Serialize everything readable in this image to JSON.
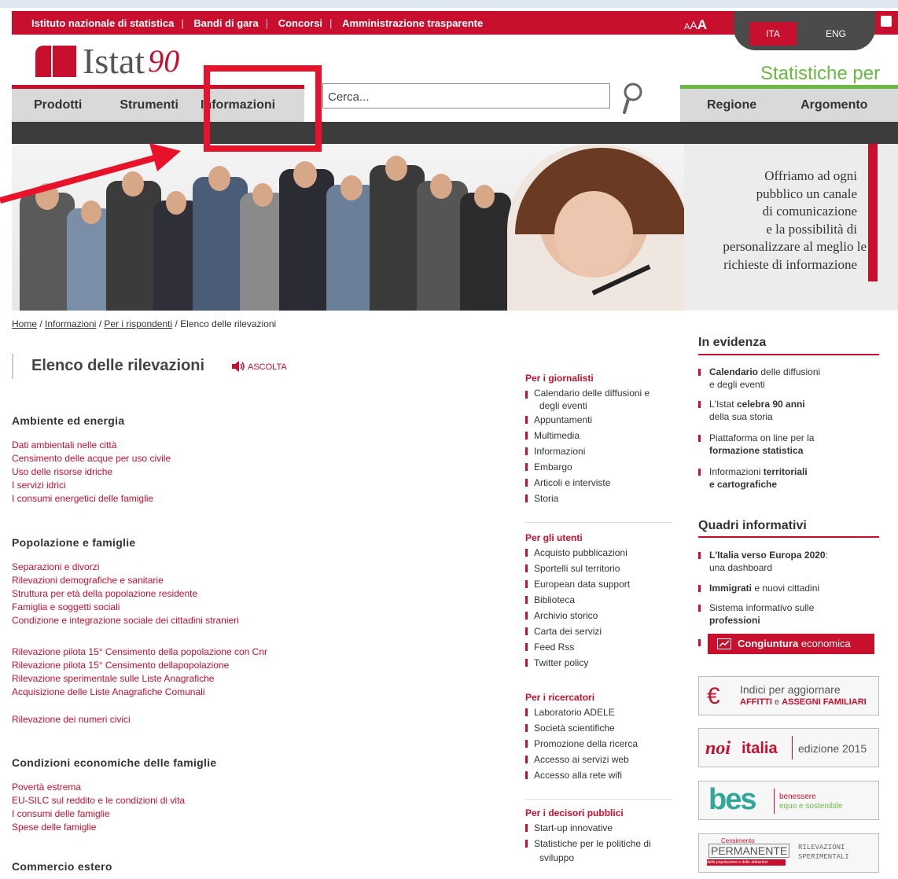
{
  "top_links": [
    "Istituto nazionale di statistica",
    "Bandi di gara",
    "Concorsi",
    "Amministrazione trasparente"
  ],
  "font_size": {
    "small": "A",
    "medium": "A",
    "large": "A"
  },
  "lang": {
    "ita": "ITA",
    "eng": "ENG"
  },
  "logo": {
    "text": "Istat",
    "ninety": "90"
  },
  "nav": {
    "items": [
      "Prodotti",
      "Strumenti",
      "Informazioni"
    ]
  },
  "search": {
    "placeholder": "Cerca..."
  },
  "stat_per": "Statistiche per",
  "right_nav": [
    "Regione",
    "Argomento"
  ],
  "hero_text": [
    "Offriamo ad ogni",
    "pubblico un canale",
    "di comunicazione",
    "e la possibilità di",
    "personalizzare al meglio le",
    "richieste di informazione"
  ],
  "breadcrumb": {
    "home": "Home",
    "informazioni": "Informazioni",
    "rispondenti": "Per i rispondenti",
    "current": "Elenco delle rilevazioni"
  },
  "page_title": "Elenco delle rilevazioni",
  "ascolta": "ASCOLTA",
  "sections": [
    {
      "title": "Ambiente ed energia",
      "groups": [
        [
          "Dati ambientali nelle città",
          "Censimento delle acque per uso civile",
          "Uso delle risorse idriche",
          "I servizi idrici",
          "I consumi energetici delle famiglie"
        ]
      ]
    },
    {
      "title": "Popolazione e famiglie",
      "groups": [
        [
          "Separazioni e divorzi",
          "Rilevazioni demografiche e sanitarie",
          "Struttura per età della popolazione residente",
          "Famiglia e soggetti sociali",
          "Condizione e integrazione sociale dei cittadini stranieri"
        ],
        [
          "Rilevazione pilota 15° Censimento della popolazione con Cnr",
          "Rilevazione pilota 15° Censimento dellapopolazione",
          "Rilevazione sperimentale sulle Liste Anagrafiche",
          "Acquisizione delle Liste Anagrafiche Comunali"
        ],
        [
          "Rilevazione dei numeri civici"
        ]
      ]
    },
    {
      "title": "Condizioni economiche delle famiglie",
      "groups": [
        [
          "Povertà estrema",
          "EU-SILC sul reddito e le condizioni di vita",
          "I consumi delle famiglie",
          "Spese delle famiglie"
        ]
      ]
    },
    {
      "title": "Commercio estero",
      "groups": []
    }
  ],
  "mid": {
    "giornalisti": {
      "title": "Per i giornalisti",
      "items": [
        "Calendario delle diffusioni e",
        "degli eventi",
        "Appuntamenti",
        "Multimedia",
        "Informazioni",
        "Embargo",
        "Articoli e interviste",
        "Storia"
      ]
    },
    "utenti": {
      "title": "Per gli utenti",
      "items": [
        "Acquisto pubblicazioni",
        "Sportelli sul territorio",
        "European data support",
        "Biblioteca",
        "Archivio storico",
        "Carta dei servizi",
        "Feed Rss",
        "Twitter policy"
      ]
    },
    "ricercatori": {
      "title": "Per i ricercatori",
      "items": [
        "Laboratorio ADELE",
        "Società scientifiche",
        "Promozione della ricerca",
        "Accesso ai servizi web",
        "Accesso alla rete wifi"
      ]
    },
    "decisori": {
      "title": "Per i decisori pubblici",
      "items": [
        "Start-up innovative",
        "Statistiche per le politiche di",
        "sviluppo"
      ]
    }
  },
  "evidenza": {
    "title": "In evidenza",
    "items": [
      {
        "b": "Calendario",
        "t": " delle diffusioni",
        "l2": "e degli eventi"
      },
      {
        "a": "L'Istat ",
        "b": "celebra 90 anni",
        "l2": "della sua storia"
      },
      {
        "a": "Piattaforma on line per la",
        "l2b": "formazione statistica"
      },
      {
        "a": "Informazioni ",
        "b": "territoriali",
        "l2b": "e cartografiche"
      }
    ]
  },
  "quadri": {
    "title": "Quadri informativi",
    "items": [
      {
        "b": "L'Italia verso Europa 2020",
        "t": ":",
        "l2": "una dashboard"
      },
      {
        "b": "Immigrati",
        "t": " e nuovi cittadini"
      },
      {
        "a": "Sistema informativo sulle",
        "l2b": "professioni"
      }
    ],
    "congiuntura": {
      "b": "Congiuntura",
      "t": " economica"
    }
  },
  "banners": {
    "indici": {
      "l1": "Indici per aggiornare",
      "b1": "AFFITTI",
      "mid": " e ",
      "b2": "ASSEGNI FAMILIARI"
    },
    "noi": {
      "logo": "noi",
      "logo2": "italia",
      "edizione": "edizione 2015"
    },
    "bes": {
      "logo": "bes",
      "l1": "benessere",
      "l2": "equo e sostenibile"
    },
    "cens": {
      "top": "Censimento",
      "main": "PERMANENTE",
      "sub": "della popolazione e delle abitazioni",
      "r1": "RILEVAZIONI",
      "r2": "SPERIMENTALI"
    }
  },
  "colors": {
    "brand": "#c8102e",
    "green": "#6bb843",
    "annotation": "#e8122a"
  }
}
